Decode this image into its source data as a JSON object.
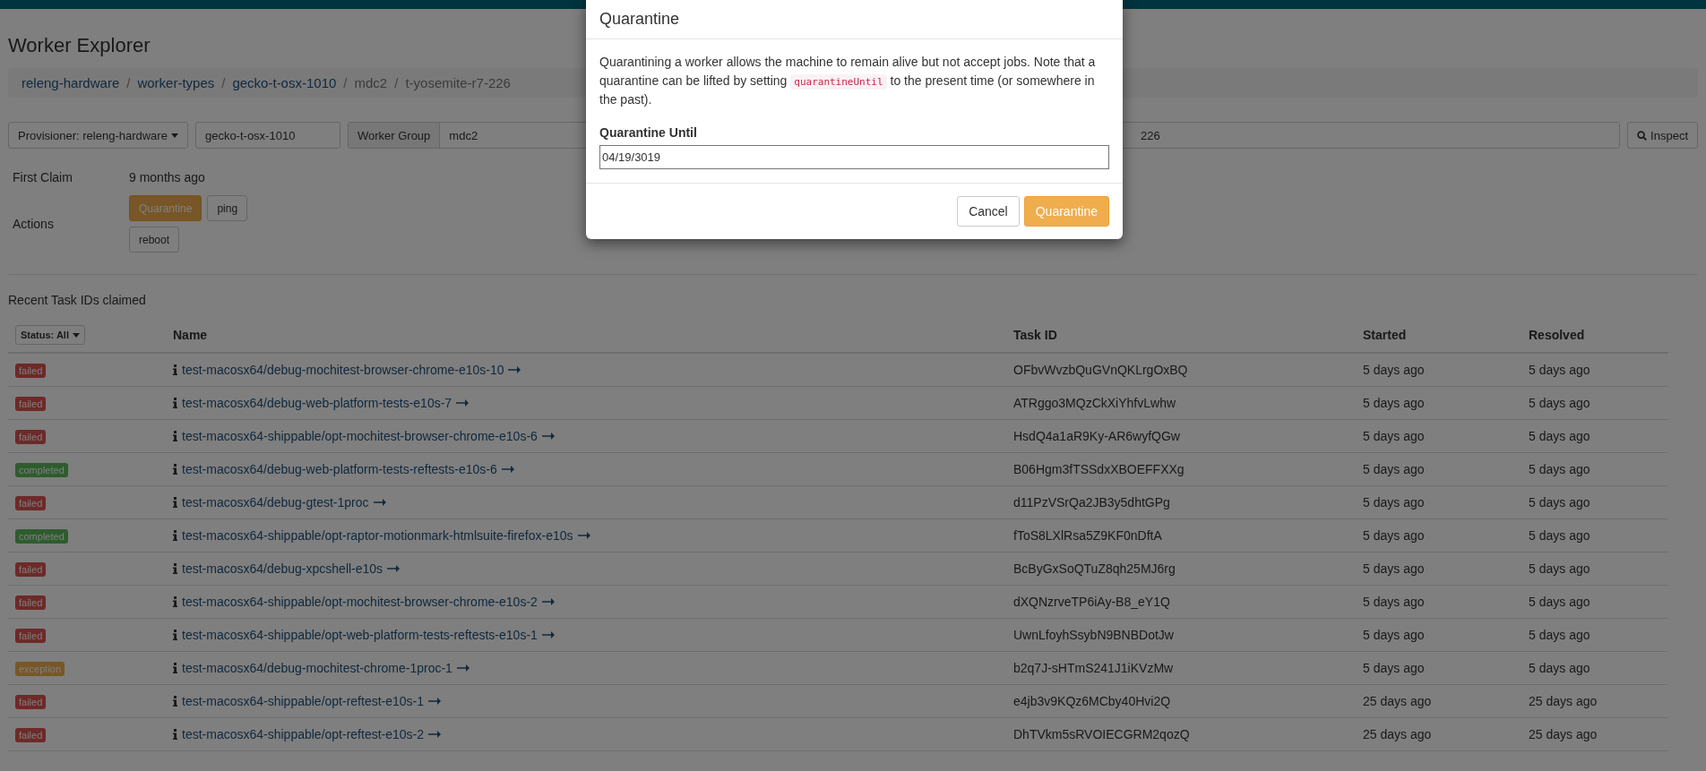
{
  "page": {
    "title": "Worker Explorer"
  },
  "breadcrumb_separator": "/",
  "breadcrumb": [
    {
      "label": "releng-hardware",
      "link": true
    },
    {
      "label": "worker-types",
      "link": true
    },
    {
      "label": "gecko-t-osx-1010",
      "link": true
    },
    {
      "label": "mdc2",
      "link": false
    },
    {
      "label": "t-yosemite-r7-226",
      "link": false
    }
  ],
  "toolbar": {
    "provisioner": "Provisioner: releng-hardware",
    "worker_type": "gecko-t-osx-1010",
    "worker_group_label": "Worker Group",
    "worker_group": "mdc2",
    "worker_id": "226",
    "inspect": "Inspect"
  },
  "details": [
    {
      "label": "First Claim",
      "value": "9 months ago"
    }
  ],
  "actions": {
    "label": "Actions",
    "buttons": [
      {
        "label": "Quarantine",
        "kind": "warning"
      },
      {
        "label": "ping",
        "kind": "default"
      },
      {
        "label": "reboot",
        "kind": "default"
      }
    ]
  },
  "recent": {
    "title": "Recent Task IDs claimed",
    "status_filter": "Status: All",
    "columns": [
      "Name",
      "Task ID",
      "Started",
      "Resolved"
    ],
    "rows": [
      {
        "status": "failed",
        "color": "#6d2a28",
        "name": "test-macosx64/debug-mochitest-browser-chrome-e10s-10",
        "task_id": "OFbvWvzbQuGVnQKLrgOxBQ",
        "started": "5 days ago",
        "resolved": "5 days ago"
      },
      {
        "status": "failed",
        "color": "#6d2a28",
        "name": "test-macosx64/debug-web-platform-tests-e10s-7",
        "task_id": "ATRggo3MQzCkXiYhfvLwhw",
        "started": "5 days ago",
        "resolved": "5 days ago"
      },
      {
        "status": "failed",
        "color": "#6d2a28",
        "name": "test-macosx64-shippable/opt-mochitest-browser-chrome-e10s-6",
        "task_id": "HsdQ4a1aR9Ky-AR6wyfQGw",
        "started": "5 days ago",
        "resolved": "5 days ago"
      },
      {
        "status": "completed",
        "color": "#2e5c2e",
        "name": "test-macosx64/debug-web-platform-tests-reftests-e10s-6",
        "task_id": "B06Hgm3fTSSdxXBOEFFXXg",
        "started": "5 days ago",
        "resolved": "5 days ago"
      },
      {
        "status": "failed",
        "color": "#6d2a28",
        "name": "test-macosx64/debug-gtest-1proc",
        "task_id": "d11PzVSrQa2JB3y5dhtGPg",
        "started": "5 days ago",
        "resolved": "5 days ago"
      },
      {
        "status": "completed",
        "color": "#2e5c2e",
        "name": "test-macosx64-shippable/opt-raptor-motionmark-htmlsuite-firefox-e10s",
        "task_id": "fToS8LXlRsa5Z9KF0nDftA",
        "started": "5 days ago",
        "resolved": "5 days ago"
      },
      {
        "status": "failed",
        "color": "#6d2a28",
        "name": "test-macosx64/debug-xpcshell-e10s",
        "task_id": "BcByGxSoQTuZ8qh25MJ6rg",
        "started": "5 days ago",
        "resolved": "5 days ago"
      },
      {
        "status": "failed",
        "color": "#6d2a28",
        "name": "test-macosx64-shippable/opt-mochitest-browser-chrome-e10s-2",
        "task_id": "dXQNzrveTP6iAy-B8_eY1Q",
        "started": "5 days ago",
        "resolved": "5 days ago"
      },
      {
        "status": "failed",
        "color": "#6d2a28",
        "name": "test-macosx64-shippable/opt-web-platform-tests-reftests-e10s-1",
        "task_id": "UwnLfoyhSsybN9BNBDotJw",
        "started": "5 days ago",
        "resolved": "5 days ago"
      },
      {
        "status": "exception",
        "color": "#785727",
        "name": "test-macosx64/debug-mochitest-chrome-1proc-1",
        "task_id": "b2q7J-sHTmS241J1iKVzMw",
        "started": "5 days ago",
        "resolved": "5 days ago"
      },
      {
        "status": "failed",
        "color": "#6d2a28",
        "name": "test-macosx64-shippable/opt-reftest-e10s-1",
        "task_id": "e4jb3v9KQz6MCby40Hvi2Q",
        "started": "25 days ago",
        "resolved": "25 days ago"
      },
      {
        "status": "failed",
        "color": "#6d2a28",
        "name": "test-macosx64-shippable/opt-reftest-e10s-2",
        "task_id": "DhTVkm5sRVOIECGRM2qozQ",
        "started": "25 days ago",
        "resolved": "25 days ago"
      }
    ]
  },
  "modal": {
    "title": "Quarantine",
    "text_before": "Quarantining a worker allows the machine to remain alive but not accept jobs. Note that a quarantine can be lifted by setting",
    "code": "quarantineUntil",
    "text_after": "to the present time (or somewhere in the past).",
    "field_label": "Quarantine Until",
    "field_value": "04/19/3019",
    "buttons": [
      {
        "label": "Cancel",
        "kind": "default"
      },
      {
        "label": "Quarantine",
        "kind": "warning"
      }
    ]
  }
}
